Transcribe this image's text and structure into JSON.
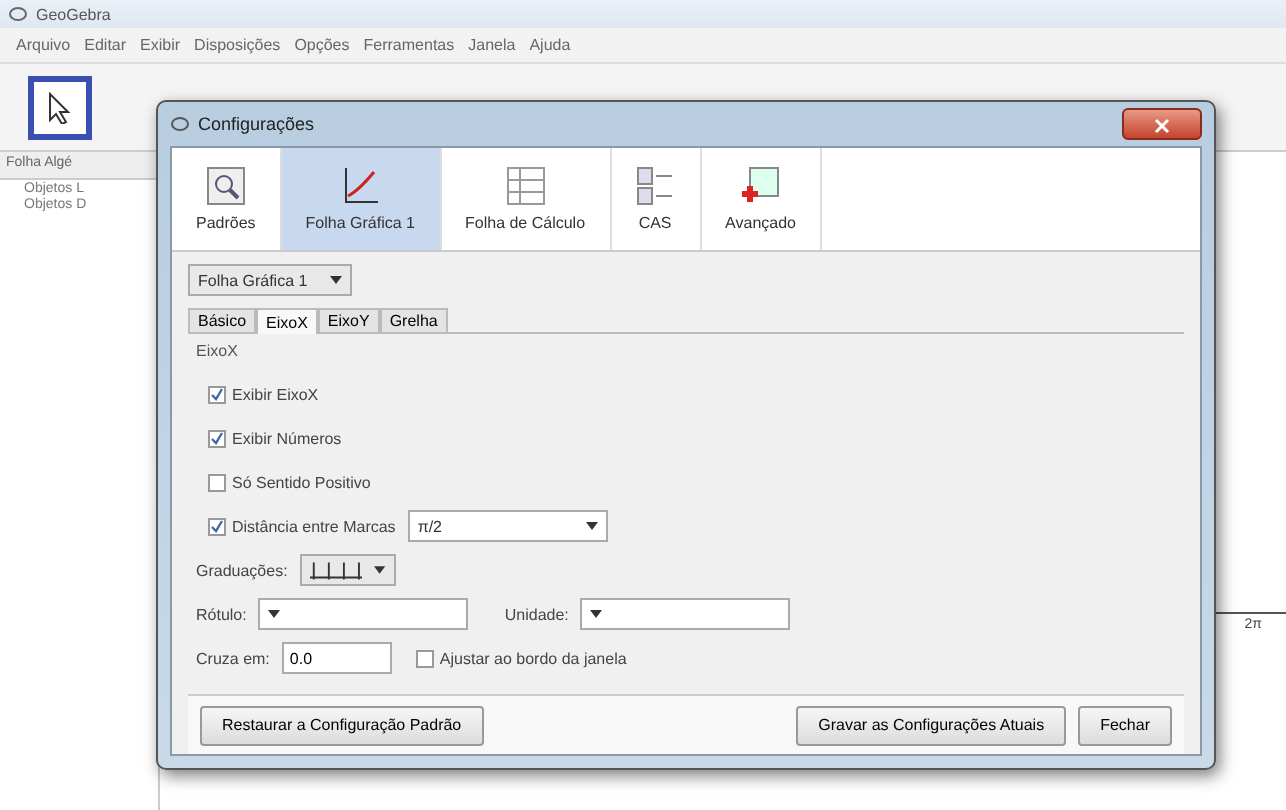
{
  "window": {
    "title": "GeoGebra"
  },
  "menu": [
    "Arquivo",
    "Editar",
    "Exibir",
    "Disposições",
    "Opções",
    "Ferramentas",
    "Janela",
    "Ajuda"
  ],
  "toolbar": [
    {
      "kind": "move",
      "selected": true
    }
  ],
  "algebra": {
    "title": "Folha Algé",
    "items": [
      "Objetos L",
      "Objetos D"
    ]
  },
  "graphics": {
    "axis_label": "2π"
  },
  "dialog": {
    "title": "Configurações",
    "categories": [
      {
        "label": "Padrões",
        "kind": "defaults",
        "selected": false
      },
      {
        "label": "Folha Gráfica 1",
        "kind": "graphics",
        "selected": true
      },
      {
        "label": "Folha de Cálculo",
        "kind": "spreadsheet",
        "selected": false
      },
      {
        "label": "CAS",
        "kind": "cas",
        "selected": false
      },
      {
        "label": "Avançado",
        "kind": "advanced",
        "selected": false
      }
    ],
    "view_select": "Folha Gráfica 1",
    "tabs": [
      {
        "label": "Básico",
        "selected": false
      },
      {
        "label": "EixoX",
        "selected": true
      },
      {
        "label": "EixoY",
        "selected": false
      },
      {
        "label": "Grelha",
        "selected": false
      }
    ],
    "group_title": "EixoX",
    "options": [
      {
        "label": "Exibir EixoX",
        "checked": true
      },
      {
        "label": "Exibir Números",
        "checked": true
      },
      {
        "label": "Só Sentido Positivo",
        "checked": false
      },
      {
        "label": "Distância entre Marcas",
        "checked": true,
        "value": "π/2"
      }
    ],
    "ticks_label": "Graduações:",
    "label_field": {
      "label": "Rótulo:"
    },
    "unit_field": {
      "label": "Unidade:"
    },
    "cross": {
      "label": "Cruza em:",
      "value": "0.0"
    },
    "snap": {
      "label": "Ajustar ao bordo da janela",
      "checked": false
    },
    "buttons": {
      "restore": "Restaurar a Configuração Padrão",
      "save": "Gravar as Configurações Atuais",
      "close": "Fechar"
    }
  }
}
